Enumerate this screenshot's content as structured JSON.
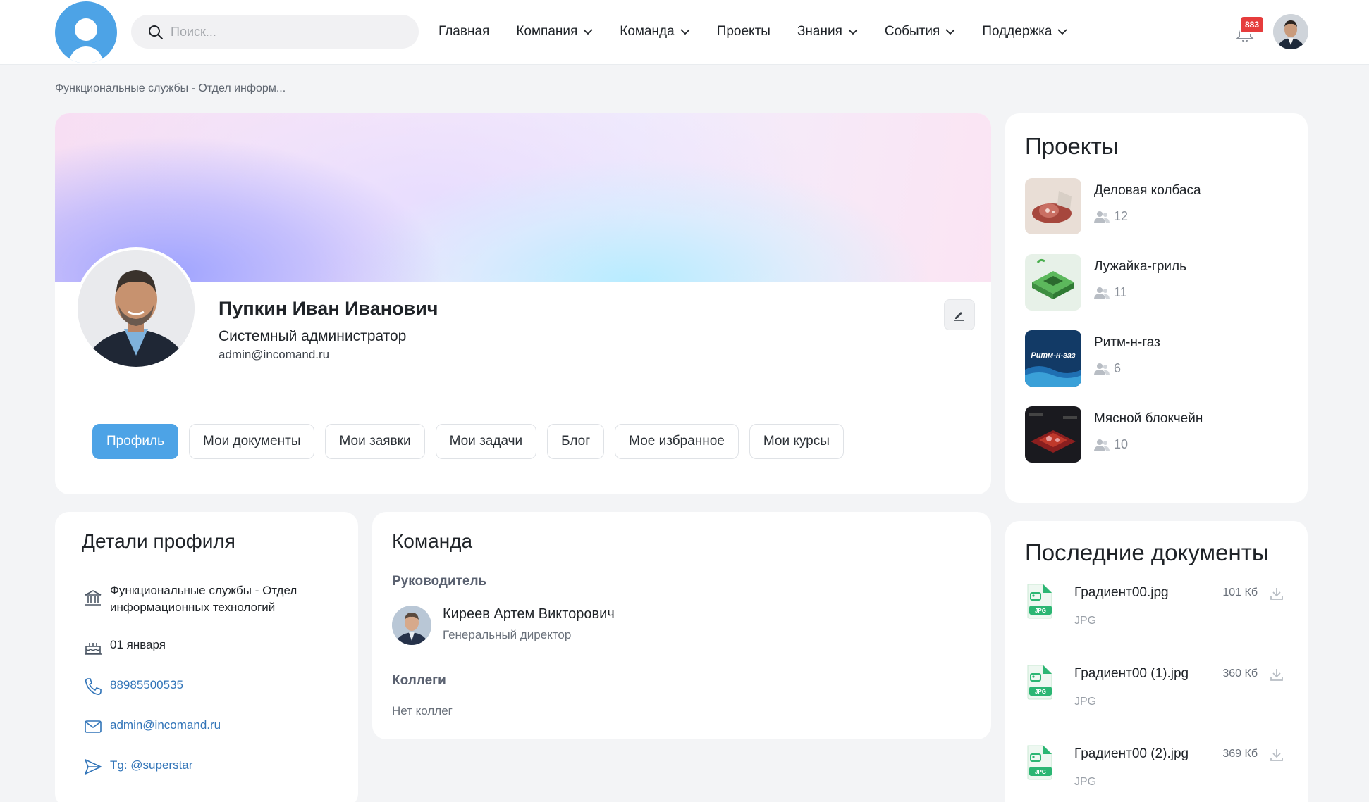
{
  "header": {
    "search_placeholder": "Поиск...",
    "nav": [
      {
        "label": "Главная",
        "dropdown": false
      },
      {
        "label": "Компания",
        "dropdown": true
      },
      {
        "label": "Команда",
        "dropdown": true
      },
      {
        "label": "Проекты",
        "dropdown": false
      },
      {
        "label": "Знания",
        "dropdown": true
      },
      {
        "label": "События",
        "dropdown": true
      },
      {
        "label": "Поддержка",
        "dropdown": true
      }
    ],
    "notifications_count": "883"
  },
  "breadcrumb": "Функциональные службы - Отдел информ...",
  "profile": {
    "name": "Пупкин Иван Иванович",
    "role": "Системный администратор",
    "email": "admin@incomand.ru",
    "tabs": [
      "Профиль",
      "Мои документы",
      "Мои заявки",
      "Мои задачи",
      "Блог",
      "Мое избранное",
      "Мои курсы"
    ],
    "active_tab": "Профиль"
  },
  "details": {
    "title": "Детали профиля",
    "department_line1": "Функциональные службы - Отдел",
    "department_line2": "информационных технологий",
    "birthday": "01 января",
    "phone": "88985500535",
    "email": "admin@incomand.ru",
    "telegram": "Tg: @superstar"
  },
  "team": {
    "title": "Команда",
    "leader_heading": "Руководитель",
    "leader_name": "Киреев Артем Викторович",
    "leader_role": "Генеральный директор",
    "colleagues_heading": "Коллеги",
    "colleagues_empty": "Нет коллег"
  },
  "projects": {
    "title": "Проекты",
    "items": [
      {
        "name": "Деловая колбаса",
        "members": "12"
      },
      {
        "name": "Лужайка-гриль",
        "members": "11"
      },
      {
        "name": "Ритм-н-газ",
        "members": "6",
        "thumb_text": "Ритм-н-газ"
      },
      {
        "name": "Мясной блокчейн",
        "members": "10"
      }
    ]
  },
  "documents": {
    "title": "Последние документы",
    "items": [
      {
        "name": "Градиент00.jpg",
        "size": "101 Кб",
        "type": "JPG"
      },
      {
        "name": "Градиент00 (1).jpg",
        "size": "360 Кб",
        "type": "JPG"
      },
      {
        "name": "Градиент00 (2).jpg",
        "size": "369 Кб",
        "type": "JPG"
      }
    ],
    "icon_label": "JPG"
  },
  "colors": {
    "accent": "#4da3e6",
    "link": "#3174b8",
    "badge": "#e63c3c",
    "doc_icon": "#2bb673"
  }
}
